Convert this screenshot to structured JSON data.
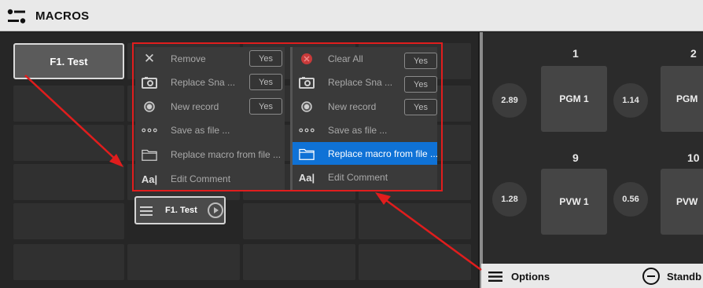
{
  "header": {
    "title": "MACROS"
  },
  "macro": {
    "label": "F1. Test"
  },
  "menu_left": [
    {
      "icon": "close-icon",
      "label": "Remove",
      "action": "Yes"
    },
    {
      "icon": "camera-icon",
      "label": "Replace Sna ...",
      "action": "Yes"
    },
    {
      "icon": "record-icon",
      "label": "New record",
      "action": "Yes"
    },
    {
      "icon": "dots-icon",
      "label": "Save as file ..."
    },
    {
      "icon": "folder-icon",
      "label": "Replace macro from file ..."
    },
    {
      "icon": "text-icon",
      "label": "Edit Comment"
    }
  ],
  "menu_right": [
    {
      "icon": "clear-all-icon",
      "label": "Clear All",
      "action": "Yes"
    },
    {
      "icon": "camera-icon",
      "label": "Replace Sna ...",
      "action": "Yes"
    },
    {
      "icon": "record-icon",
      "label": "New record",
      "action": "Yes"
    },
    {
      "icon": "dots-icon",
      "label": "Save as file ..."
    },
    {
      "icon": "folder-icon",
      "label": "Replace macro from file ...",
      "selected": true
    },
    {
      "icon": "text-icon",
      "label": "Edit Comment"
    }
  ],
  "drag_item": {
    "label": "F1. Test"
  },
  "sources": {
    "row1": {
      "col1_num": "1",
      "col2_num": "2",
      "val1": "2.89",
      "box1": "PGM 1",
      "val2": "1.14",
      "box2": "PGM"
    },
    "row2": {
      "col1_num": "9",
      "col2_num": "10",
      "val1": "1.28",
      "box1": "PVW 1",
      "val2": "0.56",
      "box2": "PVW"
    }
  },
  "footer": {
    "options_label": "Options",
    "standby_label": "Standb"
  },
  "colors": {
    "highlight": "#0f72d6",
    "annotation": "#e01d1d"
  }
}
